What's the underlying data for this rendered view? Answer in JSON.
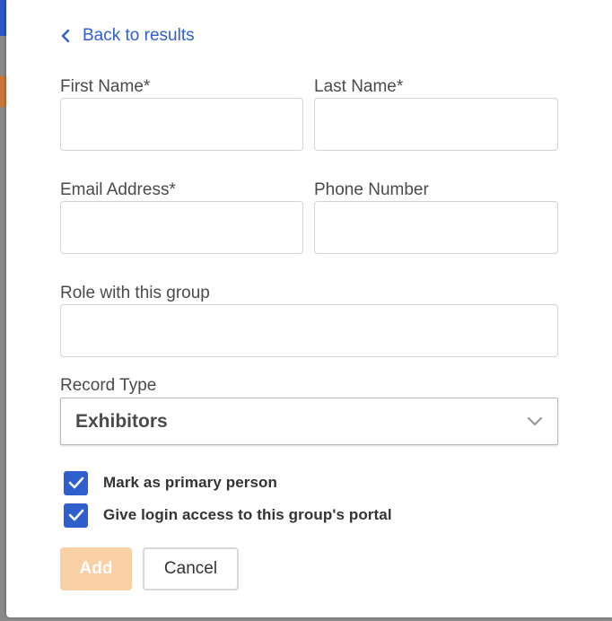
{
  "colors": {
    "accent": "#2f5fcc",
    "add_button_disabled": "#f9cfa6",
    "label_text": "#4a4a4a"
  },
  "back_link": {
    "label": "Back to results",
    "icon": "chevron-left-icon"
  },
  "form": {
    "first_name": {
      "label": "First Name*",
      "value": ""
    },
    "last_name": {
      "label": "Last Name*",
      "value": ""
    },
    "email": {
      "label": "Email Address*",
      "value": ""
    },
    "phone": {
      "label": "Phone Number",
      "value": ""
    },
    "role": {
      "label": "Role with this group",
      "value": ""
    },
    "record_type": {
      "label": "Record Type",
      "value": "Exhibitors",
      "icon": "chevron-down-icon"
    }
  },
  "options": {
    "primary_person": {
      "label": "Mark as primary person",
      "checked": true
    },
    "portal_access": {
      "label": "Give login access to this group's portal",
      "checked": true
    }
  },
  "actions": {
    "add_label": "Add",
    "add_disabled": true,
    "cancel_label": "Cancel"
  }
}
